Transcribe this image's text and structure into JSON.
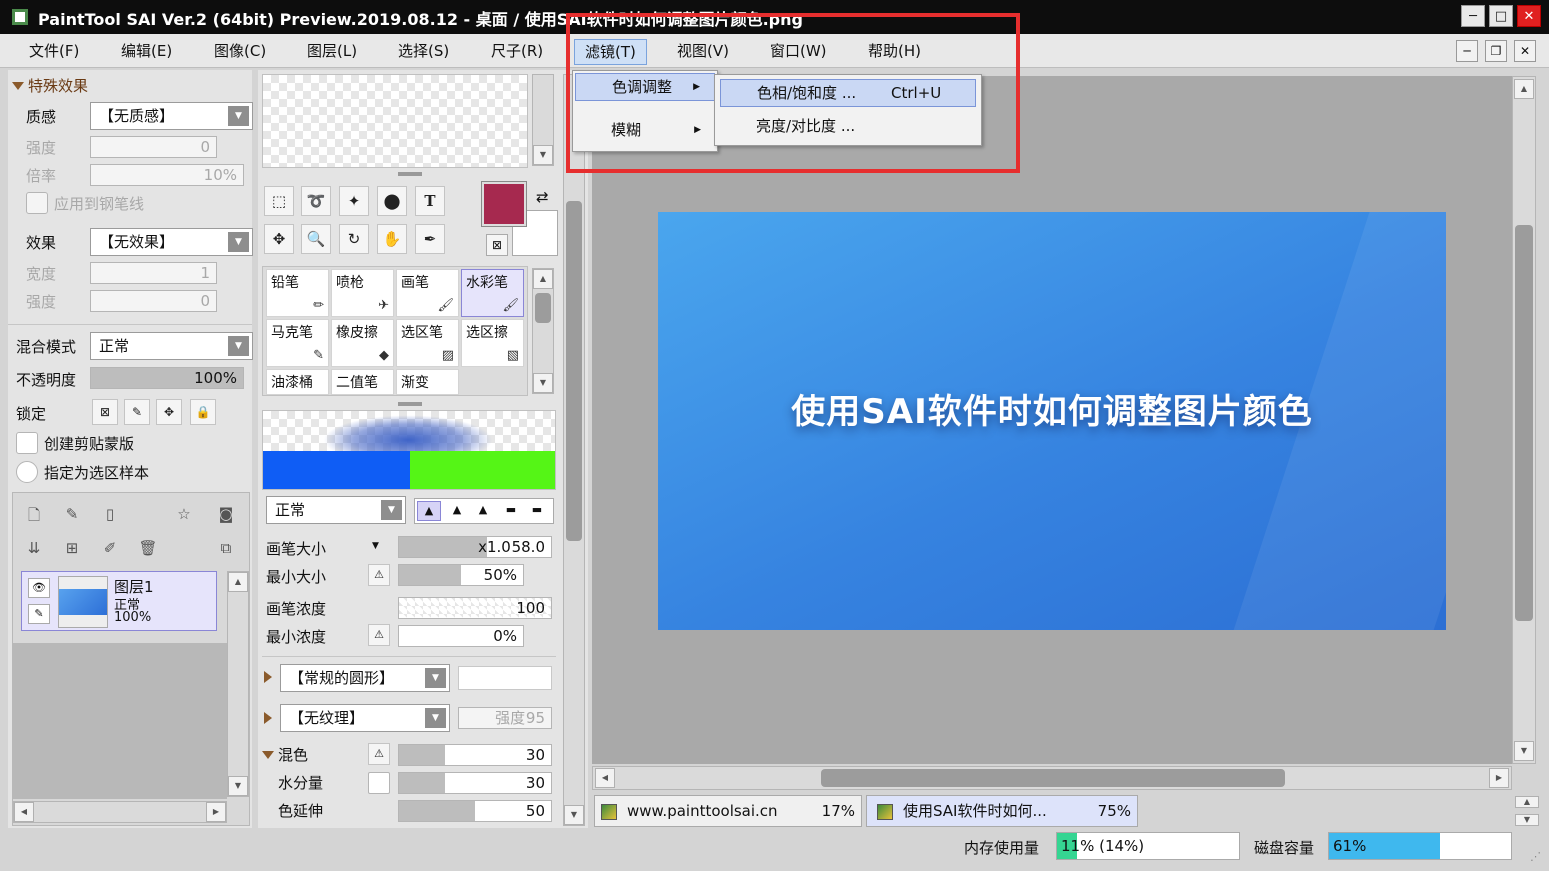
{
  "window": {
    "title": "PaintTool SAI Ver.2 (64bit) Preview.2019.08.12 - 桌面 / 使用SAI软件时如何调整图片颜色.png"
  },
  "menu": {
    "file": "文件(F)",
    "edit": "编辑(E)",
    "image": "图像(C)",
    "layer": "图层(L)",
    "select": "选择(S)",
    "ruler": "尺子(R)",
    "filter": "滤镜(T)",
    "view": "视图(V)",
    "window": "窗口(W)",
    "help": "帮助(H)"
  },
  "filter_menu": {
    "items": [
      "色调调整",
      "模糊"
    ],
    "submenu": {
      "hue_sat": "色相/饱和度 ...",
      "hue_sat_shortcut": "Ctrl+U",
      "bright_contrast": "亮度/对比度 ..."
    }
  },
  "left_panel": {
    "section": "特殊效果",
    "texture": {
      "label": "质感",
      "value": "【无质感】"
    },
    "strength1": {
      "label": "强度",
      "value": "0"
    },
    "ratio": {
      "label": "倍率",
      "value": "10%"
    },
    "apply_pen": "应用到钢笔线",
    "effect": {
      "label": "效果",
      "value": "【无效果】"
    },
    "width": {
      "label": "宽度",
      "value": "1"
    },
    "strength2": {
      "label": "强度",
      "value": "0"
    },
    "blend": {
      "label": "混合模式",
      "value": "正常"
    },
    "opacity": {
      "label": "不透明度",
      "value": "100%",
      "fraction": 1.0
    },
    "lock": "锁定",
    "clip": "创建剪贴蒙版",
    "sel_sample": "指定为选区样本",
    "layer": {
      "name": "图层1",
      "mode": "正常",
      "opacity": "100%"
    }
  },
  "tools": {
    "color": "#a6294f",
    "brushes": [
      "铅笔",
      "喷枪",
      "画笔",
      "水彩笔",
      "马克笔",
      "橡皮擦",
      "选区笔",
      "选区擦",
      "油漆桶",
      "二值笔",
      "渐变"
    ],
    "mode": "正常",
    "size": {
      "label": "画笔大小",
      "mult": "x1.0",
      "value": "58.0"
    },
    "min_size": {
      "label": "最小大小",
      "value": "50%",
      "fraction": 0.5
    },
    "density": {
      "label": "画笔浓度",
      "value": "100"
    },
    "min_density": {
      "label": "最小浓度",
      "value": "0%"
    },
    "shape": "【常规的圆形】",
    "texture": "【无纹理】",
    "tex_strength": {
      "label": "强度",
      "value": "95"
    },
    "mix": {
      "label": "混色",
      "value": "30"
    },
    "water": {
      "label": "水分量",
      "value": "30"
    },
    "extend": {
      "label": "色延伸",
      "value": "50"
    }
  },
  "canvas": {
    "text": "使用SAI软件时如何调整图片颜色"
  },
  "tabs": [
    {
      "name": "www.painttoolsai.cn",
      "zoom": "17%"
    },
    {
      "name": "使用SAI软件时如何...",
      "zoom": "75%"
    }
  ],
  "status": {
    "mem_label": "内存使用量",
    "mem_value": "11% (14%)",
    "mem_fraction": 0.11,
    "disk_label": "磁盘容量",
    "disk_value": "61%",
    "disk_fraction": 0.61
  }
}
